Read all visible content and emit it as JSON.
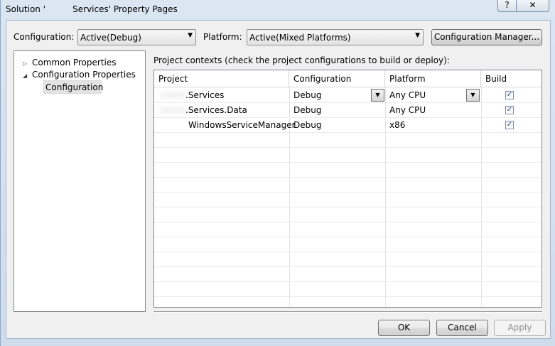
{
  "window": {
    "title": "Solution '          Services' Property Pages",
    "help_label": "?",
    "close_label": "✕"
  },
  "toolbar": {
    "configuration_label": "Configuration:",
    "configuration_value": "Active(Debug)",
    "platform_label": "Platform:",
    "platform_value": "Active(Mixed Platforms)",
    "config_manager_label": "Configuration Manager..."
  },
  "tree": {
    "items": [
      {
        "label": "Common Properties",
        "expander": "▷"
      },
      {
        "label": "Configuration Properties",
        "expander": "◢"
      },
      {
        "label": "Configuration"
      }
    ]
  },
  "contexts": {
    "label": "Project contexts (check the project configurations to build or deploy):",
    "columns": [
      "Project",
      "Configuration",
      "Platform",
      "Build"
    ],
    "rows": [
      {
        "project": ".Services",
        "configuration": "Debug",
        "platform": "Any CPU",
        "build": "✓",
        "has_dropdowns": true
      },
      {
        "project": ".Services.Data",
        "configuration": "Debug",
        "platform": "Any CPU",
        "build": "✓"
      },
      {
        "project": "WindowsServiceManager",
        "configuration": "Debug",
        "platform": "x86",
        "build": "✓"
      }
    ]
  },
  "buttons": {
    "ok": "OK",
    "cancel": "Cancel",
    "apply": "Apply"
  },
  "icons": {
    "dropdown": "▼"
  }
}
